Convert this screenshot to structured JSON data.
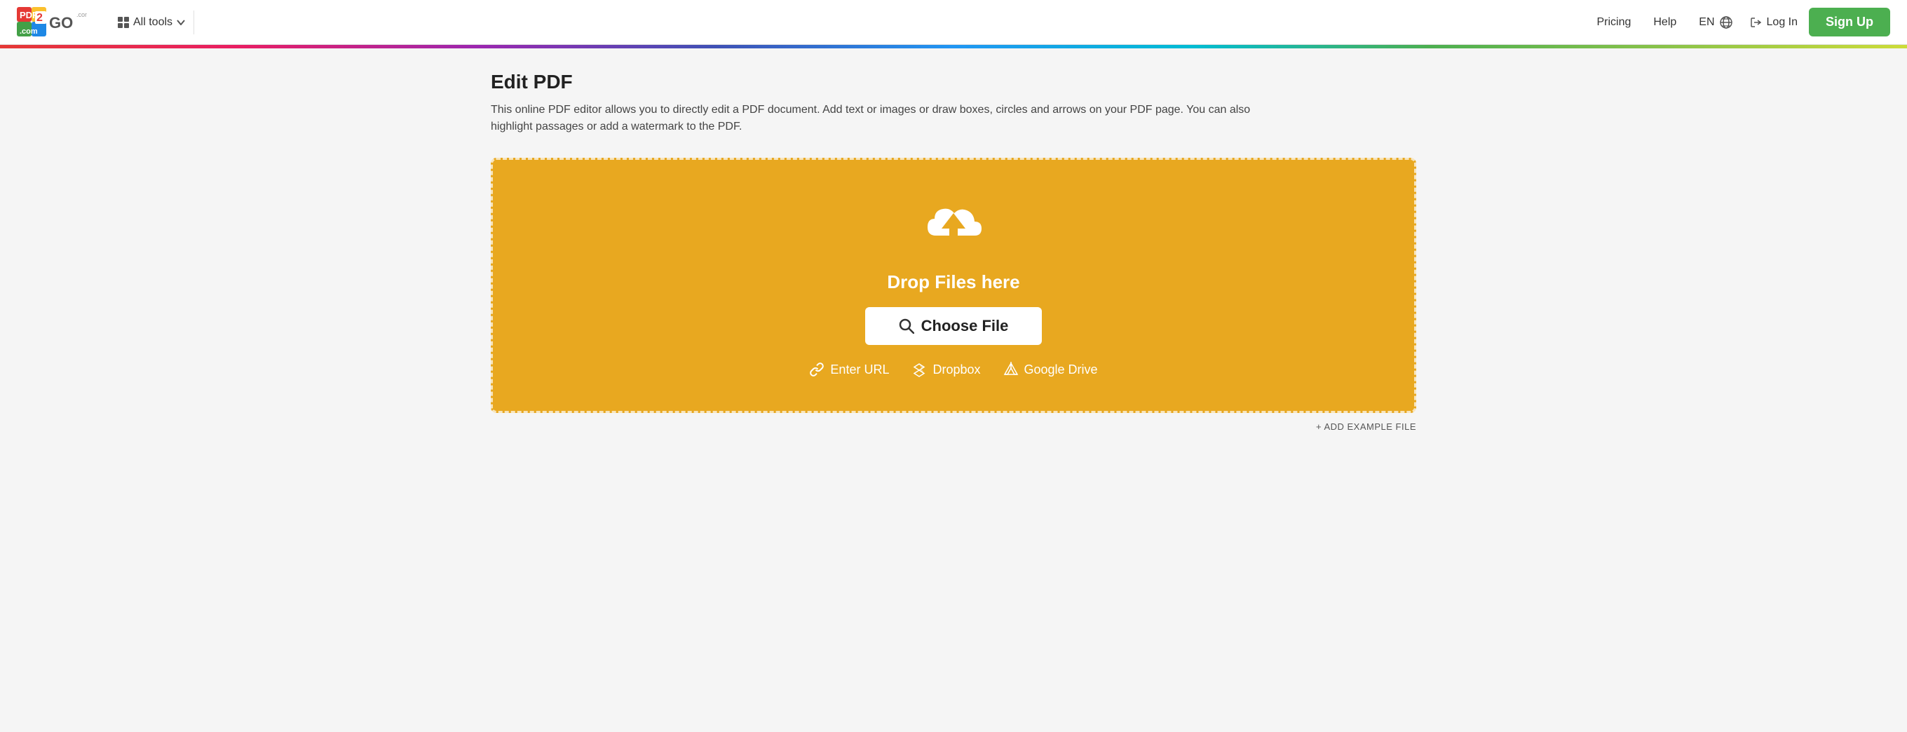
{
  "header": {
    "logo_text": "PDF2GO",
    "all_tools_label": "All tools",
    "pricing_label": "Pricing",
    "help_label": "Help",
    "language_label": "EN",
    "login_label": "Log In",
    "signup_label": "Sign Up"
  },
  "page": {
    "title": "Edit PDF",
    "description": "This online PDF editor allows you to directly edit a PDF document. Add text or images or draw boxes, circles and arrows on your PDF page. You can also highlight passages or add a watermark to the PDF."
  },
  "dropzone": {
    "drop_text": "Drop Files here",
    "choose_file_label": "Choose File",
    "enter_url_label": "Enter URL",
    "dropbox_label": "Dropbox",
    "google_drive_label": "Google Drive"
  },
  "footer": {
    "add_example_label": "+ ADD EXAMPLE FILE"
  }
}
